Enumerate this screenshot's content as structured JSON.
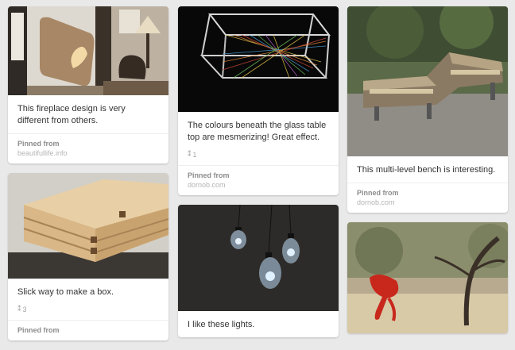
{
  "pins": [
    {
      "id": "fireplace",
      "image": "fireplace-room-photo",
      "description": "This fireplace design is very different from others.",
      "repins": null,
      "pinned_from_label": "Pinned from",
      "source": "beautifullife.info"
    },
    {
      "id": "box",
      "image": "wooden-box-photo",
      "description": "Slick way to make a box.",
      "repins": "3",
      "pinned_from_label": "Pinned from",
      "source": ""
    },
    {
      "id": "glass-table",
      "image": "string-glass-table-photo",
      "description": "The colours beneath the glass table top are mesmerizing! Great effect.",
      "repins": "1",
      "pinned_from_label": "Pinned from",
      "source": "dornob.com"
    },
    {
      "id": "lights",
      "image": "hanging-bulb-lights-photo",
      "description": "I like these lights.",
      "repins": null,
      "pinned_from_label": "",
      "source": ""
    },
    {
      "id": "bench",
      "image": "multi-level-bench-photo",
      "description": "This multi-level bench is interesting.",
      "repins": null,
      "pinned_from_label": "Pinned from",
      "source": "dornob.com"
    },
    {
      "id": "chair",
      "image": "red-sculpture-chair-photo",
      "description": "",
      "repins": null,
      "pinned_from_label": "",
      "source": ""
    }
  ],
  "icons": {
    "repin": "repin-icon"
  },
  "colors": {
    "background": "#e9e9e9",
    "card": "#ffffff",
    "text": "#333333",
    "muted": "#a5a5a5"
  }
}
